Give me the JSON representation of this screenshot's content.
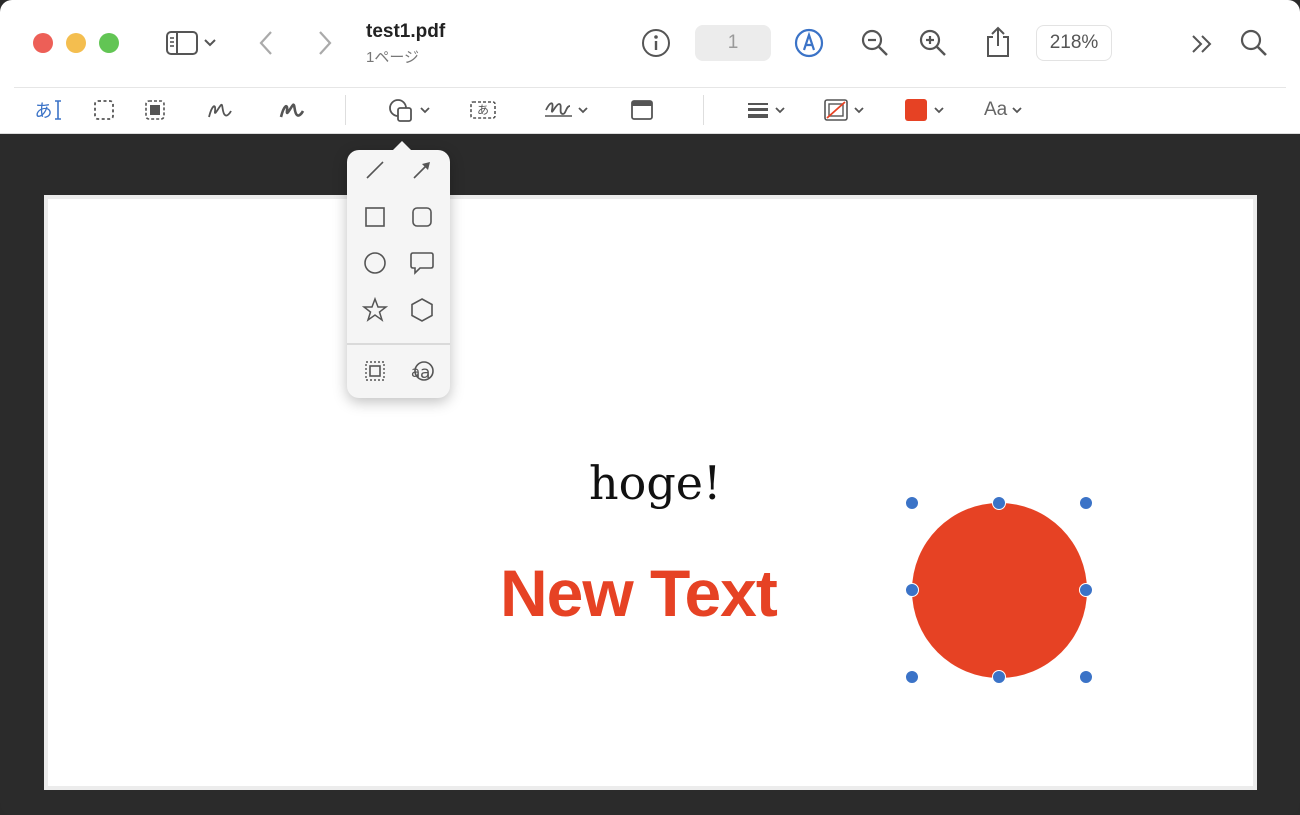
{
  "window": {
    "title": "test1.pdf",
    "subtitle": "1ページ",
    "traffic_lights": {
      "close": "#ed5f57",
      "minimize": "#f4be4f",
      "zoom": "#62c554"
    }
  },
  "toolbar": {
    "icons": [
      "sidebar-icon",
      "chevron-down-icon",
      "back-icon",
      "forward-icon",
      "info-icon",
      "markup-pen-icon",
      "zoom-out-icon",
      "zoom-in-icon",
      "share-icon",
      "more-icon",
      "search-icon"
    ],
    "page_number": "1",
    "zoom_level": "218%"
  },
  "markup_toolbar": {
    "text_selection_label": "あ",
    "text_box_label": "あ",
    "font_label": "Aa",
    "accent_color": "#3b73c7",
    "fill_color": "#e64224"
  },
  "shapes_popover": {
    "items": [
      "line-icon",
      "arrow-icon",
      "square-icon",
      "rounded-square-icon",
      "circle-icon",
      "speech-bubble-icon",
      "star-icon",
      "hexagon-icon",
      "mask-icon",
      "loupe-icon"
    ]
  },
  "document": {
    "text_1": "hoge!",
    "text_2": "New Text",
    "text_2_color": "#e64224",
    "shape_color": "#e64224",
    "handle_color": "#3b73c7"
  }
}
